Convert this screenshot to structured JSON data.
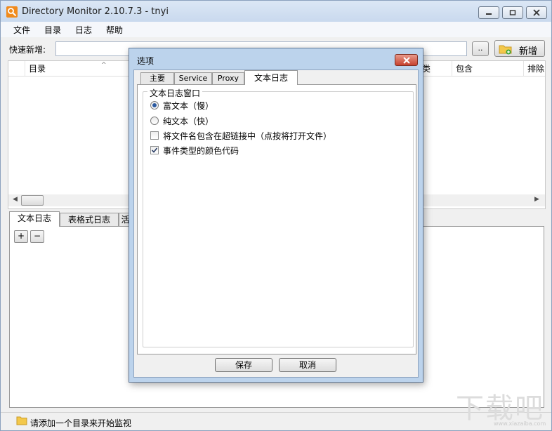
{
  "window": {
    "title": "Directory Monitor 2.10.7.3 - tnyi"
  },
  "menu": {
    "items": [
      "文件",
      "目录",
      "日志",
      "帮助"
    ]
  },
  "quick_add": {
    "label": "快速新增:",
    "value": "",
    "browse_label": "..",
    "add_label": "新增"
  },
  "dir_list": {
    "columns": [
      "目录",
      "类",
      "包含",
      "排除"
    ]
  },
  "log_tabs": [
    "文本日志",
    "表格式日志",
    "活"
  ],
  "log_controls": {
    "plus": "+",
    "minus": "−"
  },
  "status": {
    "text": "请添加一个目录来开始监视"
  },
  "watermark": {
    "main": "下载吧",
    "url": "www.xiazaiba.com"
  },
  "dialog": {
    "title": "选项",
    "tabs": [
      "主要",
      "Service",
      "Proxy",
      "文本日志"
    ],
    "active_tab": 3,
    "group_title": "文本日志窗口",
    "radios": [
      {
        "label": "富文本（慢）",
        "checked": true
      },
      {
        "label": "纯文本（快）",
        "checked": false
      }
    ],
    "checkboxes": [
      {
        "label": "将文件名包含在超链接中（点按将打开文件）",
        "checked": false
      },
      {
        "label": "事件类型的颜色代码",
        "checked": true
      }
    ],
    "save_label": "保存",
    "cancel_label": "取消"
  },
  "colors": {
    "accent": "#f08a1c",
    "close_button": "#c7412e",
    "radio_dot": "#2c5aa0"
  }
}
